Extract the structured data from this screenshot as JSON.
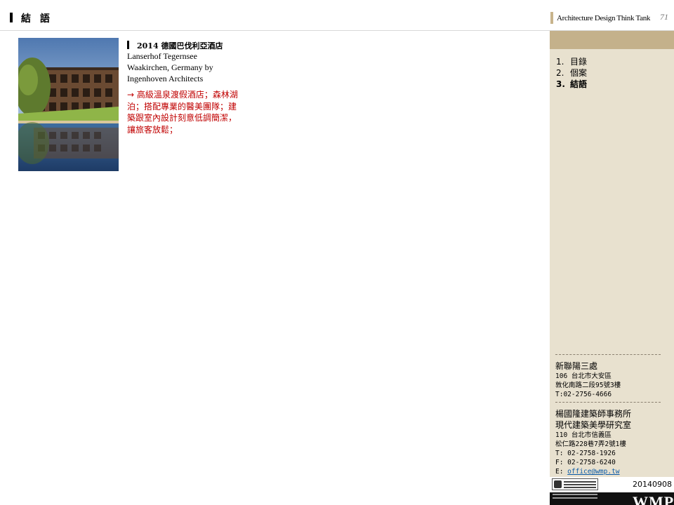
{
  "header": {
    "section_title": "結 語",
    "tank_label": "Architecture Design Think Tank",
    "page_number": "71"
  },
  "project": {
    "title": "2014 德國巴伐利亞酒店",
    "name_line": "Lanserhof Tegernsee",
    "location_line": "Waakirchen, Germany by",
    "architect_line": "Ingenhoven Architects",
    "description": "→ 高級溫泉渡假酒店；森林湖泊；搭配專業的醫美團隊；建築跟室內設計刻意低調簡潔，讓旅客放鬆；"
  },
  "sidebar": {
    "toc": [
      {
        "num": "1.",
        "label": "目錄",
        "active": false
      },
      {
        "num": "2.",
        "label": "個案",
        "active": false
      },
      {
        "num": "3.",
        "label": "結語",
        "active": true
      }
    ],
    "office1": {
      "name": "新聯陽三處",
      "address1": "106 台北市大安區",
      "address2": "敦化南路二段95號3樓",
      "phone": "T:02-2756-4666"
    },
    "office2": {
      "name1": "楊國隆建築師事務所",
      "name2": "現代建築美學研究室",
      "address1": "110 台北市信義區",
      "address2": "松仁路228巷7弄2號1樓",
      "phone": "T: 02-2758-1926",
      "fax": "F: 02-2758-6240",
      "email_prefix": "E: ",
      "email": "office@wmp.tw"
    },
    "date": "20140908",
    "brand": "WMP"
  },
  "colors": {
    "sidebar_bg": "#e8e1cf",
    "sidebar_band": "#c4b18b",
    "accent_text": "#c00000"
  }
}
